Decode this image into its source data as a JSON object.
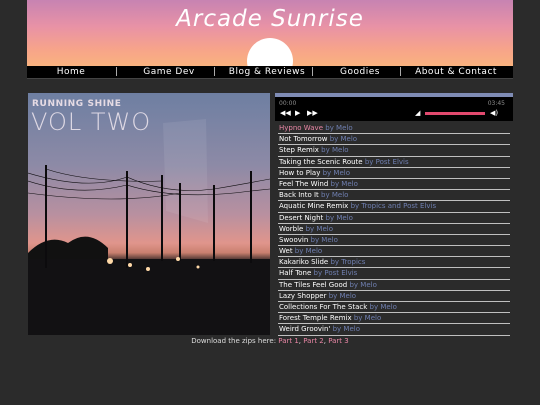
{
  "site": {
    "title": "Arcade Sunrise"
  },
  "nav": {
    "items": [
      {
        "label": "Home"
      },
      {
        "label": "Game Dev"
      },
      {
        "label": "Blog & Reviews"
      },
      {
        "label": "Goodies"
      },
      {
        "label": "About & Contact"
      }
    ],
    "separator": "|"
  },
  "album": {
    "title": "RUNNING SHINE",
    "subtitle": "VOL TWO",
    "art_icon": "sunset-power-lines-photo"
  },
  "player": {
    "elapsed": "00:00",
    "duration": "03:45",
    "progress_fraction": 0.0,
    "volume_fraction": 1.0,
    "icons": {
      "previous": "previous-icon",
      "play": "play-icon",
      "next": "next-icon",
      "mute": "volume-mute-icon",
      "volume_max": "volume-max-icon"
    },
    "colors": {
      "accent": "#e24a6f",
      "border": "#7f8cb5"
    }
  },
  "playlist": [
    {
      "title": "Hypno Wave",
      "by": "by Melo",
      "active": true
    },
    {
      "title": "Not Tomorrow",
      "by": "by Melo"
    },
    {
      "title": "Step Remix",
      "by": "by Melo"
    },
    {
      "title": "Taking the Scenic Route",
      "by": "by Post Elvis"
    },
    {
      "title": "How to Play",
      "by": "by Melo"
    },
    {
      "title": "Feel The Wind",
      "by": "by Melo"
    },
    {
      "title": "Back Into It",
      "by": "by Melo"
    },
    {
      "title": "Aquatic Mine Remix",
      "by": "by Tropics and Post Elvis"
    },
    {
      "title": "Desert Night",
      "by": "by Melo"
    },
    {
      "title": "Worble",
      "by": "by Melo"
    },
    {
      "title": "Swoovin",
      "by": "by Melo"
    },
    {
      "title": "Wet",
      "by": "by Melo"
    },
    {
      "title": "Kakariko Slide",
      "by": "by Tropics"
    },
    {
      "title": "Half Tone",
      "by": "by Post Elvis"
    },
    {
      "title": "The Tiles Feel Good",
      "by": "by Melo"
    },
    {
      "title": "Lazy Shopper",
      "by": "by Melo"
    },
    {
      "title": "Collections For The Stack",
      "by": "by Melo"
    },
    {
      "title": "Forest Temple Remix",
      "by": "by Melo"
    },
    {
      "title": "Weird Groovin'",
      "by": "by Melo"
    }
  ],
  "downloads": {
    "prefix": "Download the zips here:",
    "links": [
      "Part 1",
      "Part 2",
      "Part 3"
    ],
    "separator": ","
  },
  "colors": {
    "background": "#2b2b2b",
    "link": "#e886a5",
    "artist": "#6f7fb0"
  }
}
